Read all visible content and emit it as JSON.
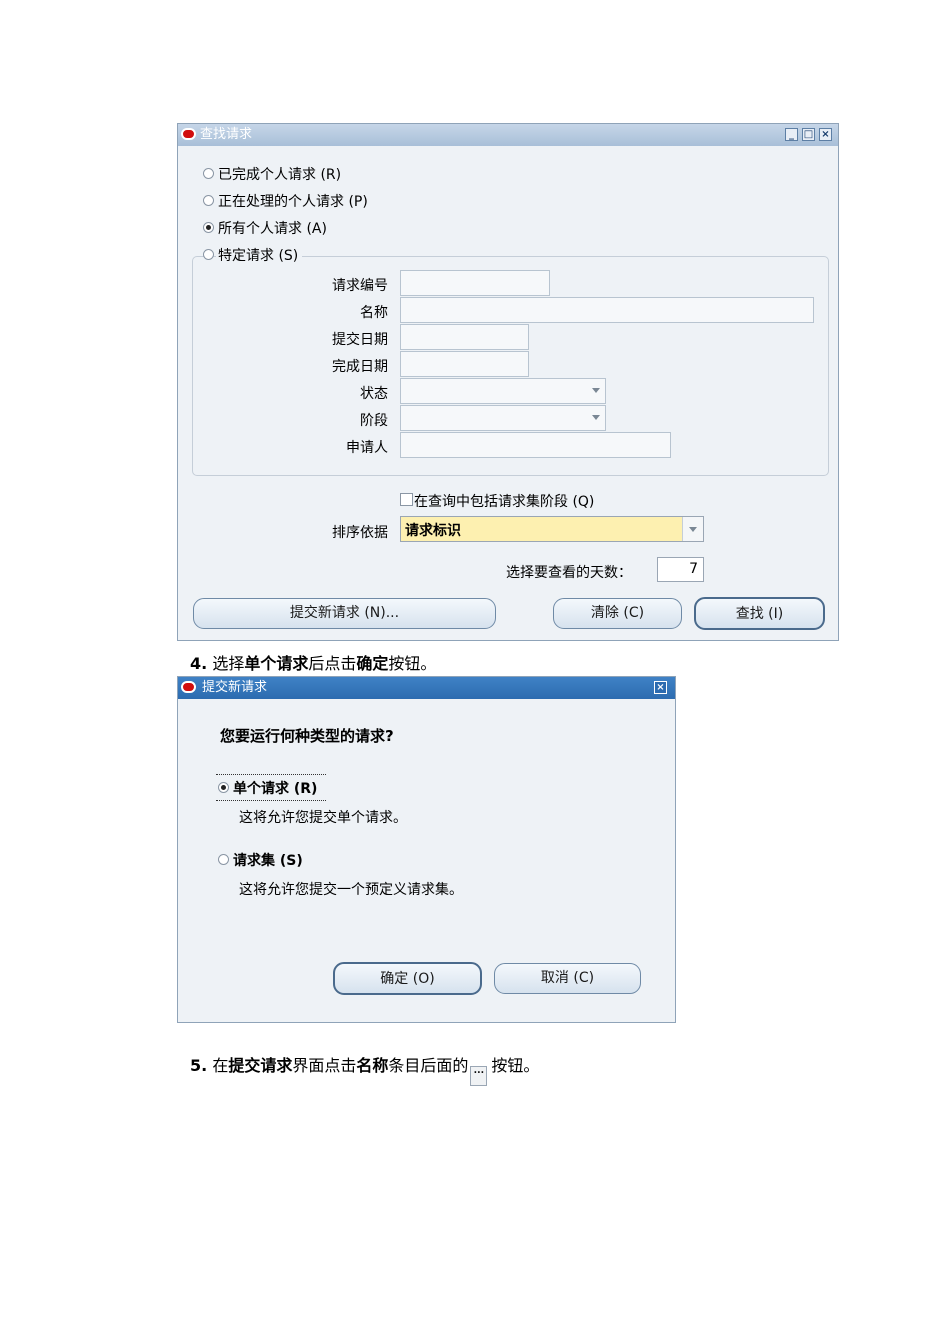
{
  "find_dialog": {
    "title": "查找请求",
    "radios": {
      "completed": "已完成个人请求 (R)",
      "processing": "正在处理的个人请求 (P)",
      "all": "所有个人请求 (A)",
      "specific": "特定请求 (S)"
    },
    "selected_radio": "all",
    "fields": {
      "request_id": "请求编号",
      "name": "名称",
      "submit_date": "提交日期",
      "complete_date": "完成日期",
      "status": "状态",
      "phase": "阶段",
      "requester": "申请人"
    },
    "include_set_stages": "在查询中包括请求集阶段 (Q)",
    "sort_by_label": "排序依据",
    "sort_by_value": "请求标识",
    "days_label": "选择要查看的天数：",
    "days_value": "7",
    "buttons": {
      "submit_new": "提交新请求 (N)...",
      "clear": "清除 (C)",
      "find": "查找 (I)"
    }
  },
  "step4": {
    "num": "4.",
    "p1": "选择",
    "b1": "单个请求",
    "p2": "后点击",
    "b2": "确定",
    "p3": "按钮。"
  },
  "submit_dialog": {
    "title": "提交新请求",
    "question": "您要运行何种类型的请求?",
    "single_label": "单个请求 (R)",
    "single_desc": "这将允许您提交单个请求。",
    "set_label": "请求集 (S)",
    "set_desc": "这将允许您提交一个预定义请求集。",
    "selected": "single",
    "ok_button": "确定 (O)",
    "cancel_button": "取消 (C)"
  },
  "step5": {
    "num": "5.",
    "p1": "在",
    "b1": "提交请求",
    "p2": "界面点击",
    "b2": "名称",
    "p3": "条目后面的",
    "p4": "按钮。"
  }
}
